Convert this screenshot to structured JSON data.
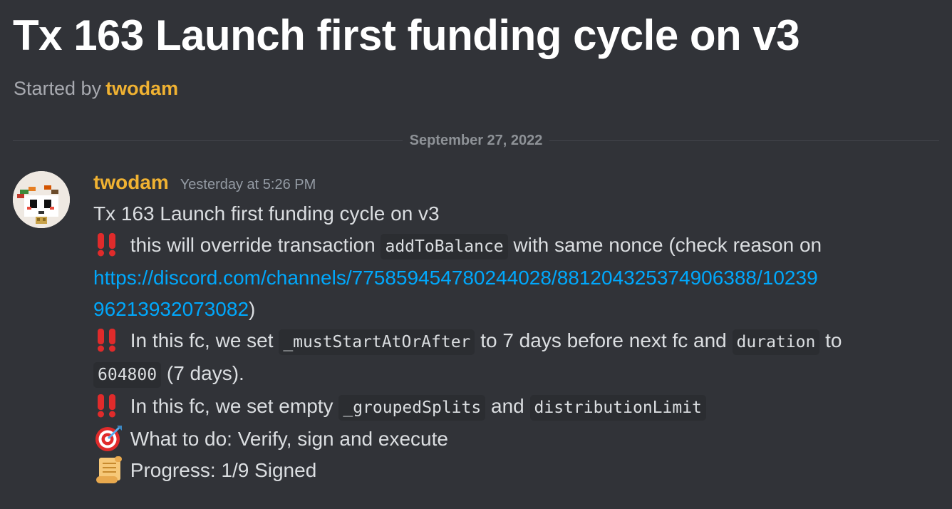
{
  "thread": {
    "title": "Tx 163 Launch first funding cycle on v3",
    "started_by_label": "Started by",
    "started_by_user": "twodam"
  },
  "divider": {
    "date": "September 27, 2022"
  },
  "message": {
    "author": "twodam",
    "timestamp": "Yesterday at 5:26 PM",
    "line1": "Tx 163 Launch first funding cycle on v3",
    "line2_a": " this will override transaction ",
    "line2_code": "addToBalance",
    "line2_b": " with same nonce (check reason on",
    "link_part1": "https://discord.com/channels/775859454780244028/881204325374906388/10239",
    "link_part2": "96213932073082",
    "link_close": ")",
    "line3_a": " In this fc, we set ",
    "line3_code1": "_mustStartAtOrAfter",
    "line3_b": " to 7 days before next fc and ",
    "line3_code2": "duration",
    "line3_c": " to",
    "line4_code": "604800",
    "line4_b": " (7 days).",
    "line5_a": " In this fc, we set empty ",
    "line5_code1": "_groupedSplits",
    "line5_b": " and ",
    "line5_code2": "distributionLimit",
    "line6": " What to do: Verify, sign and execute",
    "line7": " Progress: 1/9 Signed"
  },
  "icons": {
    "warning": "double-exclamation-icon",
    "target": "direct-hit-icon",
    "scroll": "scroll-icon"
  },
  "colors": {
    "background": "#313338",
    "username": "#f0b232",
    "link": "#00a8fc",
    "code_bg": "#2b2d31",
    "muted": "#949ba4"
  }
}
